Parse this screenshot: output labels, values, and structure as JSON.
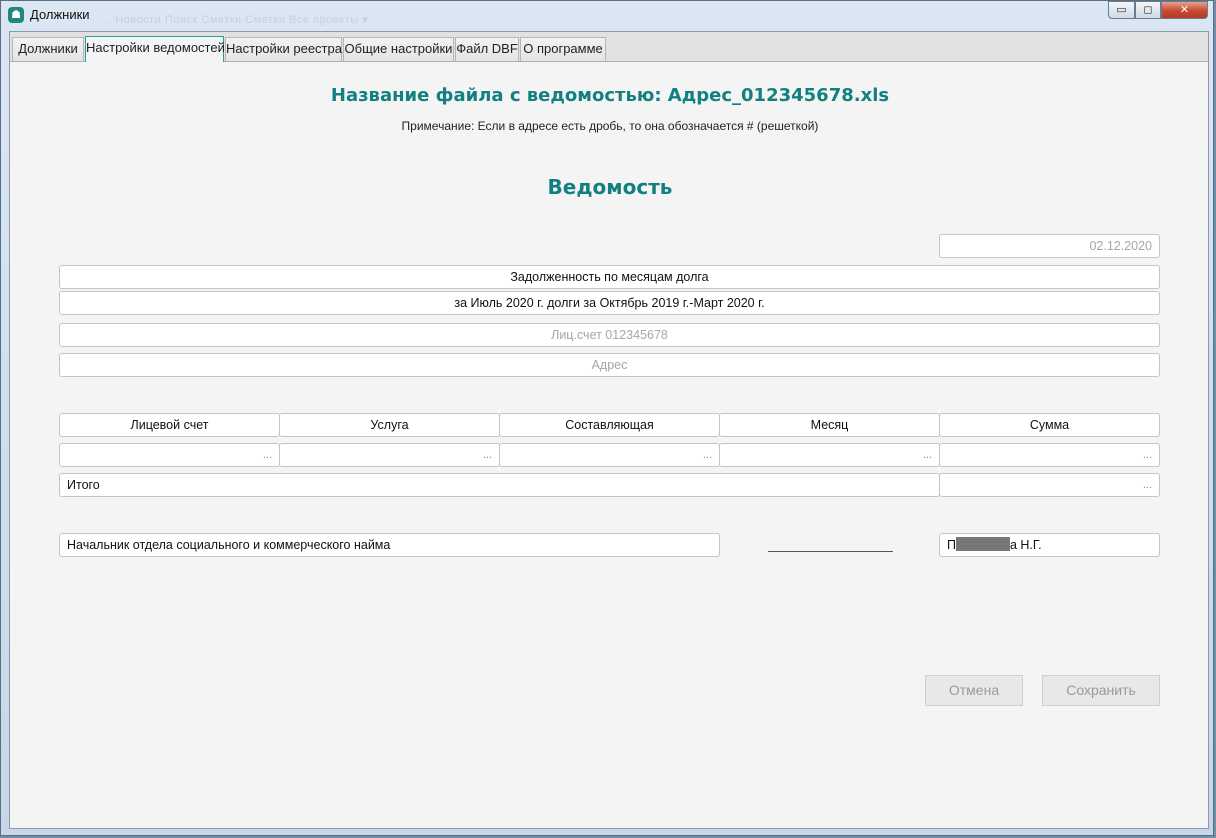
{
  "window": {
    "title": "Должники",
    "ghost_menu": "...   Новости   Поиск   Сметки   Сметки   Все проекты ▾",
    "controls": {
      "minimize": "▭",
      "maximize": "◻",
      "close": "✕"
    }
  },
  "tabs": [
    {
      "label": "Должники"
    },
    {
      "label": "Настройки ведомостей"
    },
    {
      "label": "Настройки реестра"
    },
    {
      "label": "Общие настройки"
    },
    {
      "label": "Файл DBF"
    },
    {
      "label": "О программе"
    }
  ],
  "header": {
    "file_title": "Название файла с ведомостью: Адрес_012345678.xls",
    "note": "Примечание: Если в адресе есть дробь, то она обозначается # (решеткой)",
    "statement_title": "Ведомость"
  },
  "form": {
    "date": "02.12.2020",
    "debt_title": "Задолженность по месяцам долга",
    "period": "за Июль 2020 г. долги за Октябрь 2019 г.-Март 2020 г.",
    "account_placeholder": "Лиц.счет 012345678",
    "address_placeholder": "Адрес"
  },
  "table": {
    "headers": [
      "Лицевой счет",
      "Услуга",
      "Составляющая",
      "Месяц",
      "Сумма"
    ],
    "row_placeholder": "...",
    "total_label": "Итого",
    "total_value": "..."
  },
  "signature": {
    "position": "Начальник отдела социального и коммерческого найма",
    "name_prefix": "П",
    "name_suffix": "а Н.Г."
  },
  "buttons": {
    "cancel": "Отмена",
    "save": "Сохранить"
  }
}
